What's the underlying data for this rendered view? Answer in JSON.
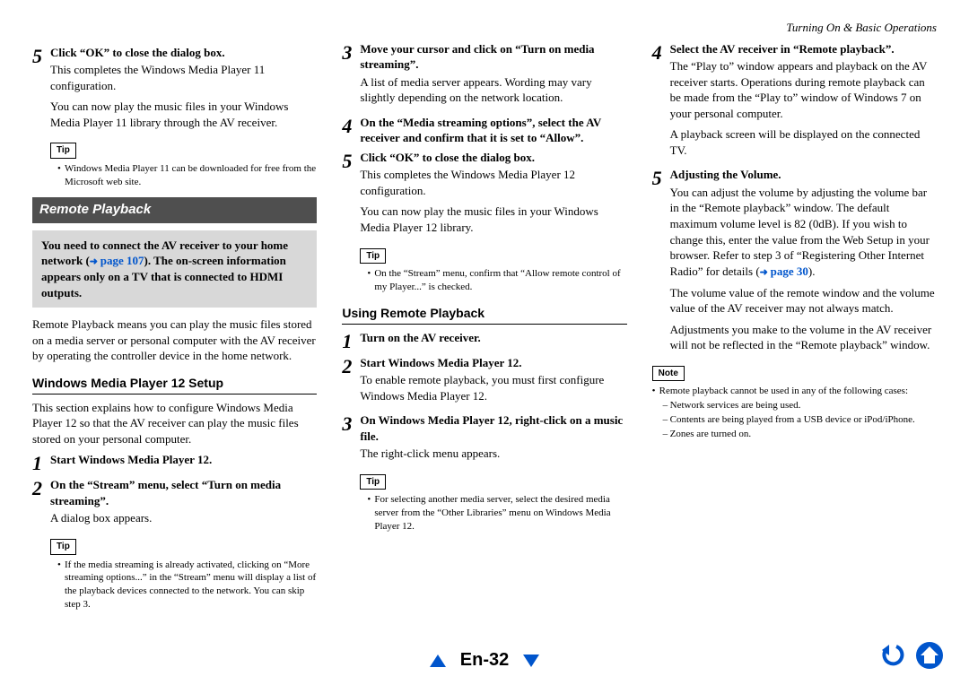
{
  "header": {
    "chapter": "Turning On & Basic Operations"
  },
  "col1": {
    "step5": {
      "num": "5",
      "title": "Click “OK” to close the dialog box.",
      "body1": "This completes the Windows Media Player 11 configuration.",
      "body2": "You can now play the music files in your Windows Media Player 11 library through the AV receiver."
    },
    "tip_label": "Tip",
    "tip_bullet": "Windows Media Player 11 can be downloaded for free from the Microsoft web site.",
    "section_bar": "Remote Playback",
    "callout_pre": "You need to connect the AV receiver to your home network (",
    "callout_link": "page 107",
    "callout_post": "). The on-screen information appears only on a TV that is connected to HDMI outputs.",
    "intro": "Remote Playback means you can play the music files stored on a media server or personal computer with the AV receiver by operating the controller device in the home network.",
    "sub1": "Windows Media Player 12 Setup",
    "sub1_intro": "This section explains how to configure Windows Media Player 12 so that the AV receiver can play the music files stored on your personal computer.",
    "s1": {
      "num": "1",
      "title": "Start Windows Media Player 12."
    },
    "s2": {
      "num": "2",
      "title": "On the “Stream” menu, select “Turn on media streaming”.",
      "body": "A dialog box appears."
    },
    "tip2_label": "Tip",
    "tip2_bullet": "If the media streaming is already activated, clicking on “More streaming options...” in the “Stream” menu will display a list of the playback devices connected to the network. You can skip step 3."
  },
  "col2": {
    "s3": {
      "num": "3",
      "title": "Move your cursor and click on “Turn on media streaming”.",
      "body": "A list of media server appears. Wording may vary slightly depending on the network location."
    },
    "s4": {
      "num": "4",
      "title": "On the “Media streaming options”, select the AV receiver and confirm that it is set to “Allow”."
    },
    "s5": {
      "num": "5",
      "title": "Click “OK” to close the dialog box.",
      "body1": "This completes the Windows Media Player 12 configuration.",
      "body2": "You can now play the music files in your Windows Media Player 12 library."
    },
    "tip_label": "Tip",
    "tip_bullet": "On the “Stream” menu, confirm that “Allow remote control of my Player...” is checked.",
    "sub": "Using Remote Playback",
    "u1": {
      "num": "1",
      "title": "Turn on the AV receiver."
    },
    "u2": {
      "num": "2",
      "title": "Start Windows Media Player 12.",
      "body": "To enable remote playback, you must first configure Windows Media Player 12."
    },
    "u3": {
      "num": "3",
      "title": "On Windows Media Player 12, right-click on a music file.",
      "body": "The right-click menu appears."
    },
    "tip2_label": "Tip",
    "tip2_bullet": "For selecting another media server, select the desired media server from the “Other Libraries” menu on Windows Media Player 12.",
    "u4": {
      "num": "4",
      "title": "Select the AV receiver in “Remote playback”.",
      "body1": "The “Play to” window appears and playback on the AV receiver starts. Operations during remote playback can be made from the “Play to” window of Windows 7 on your personal computer.",
      "body2": "A playback screen will be displayed on the connected TV."
    }
  },
  "col3": {
    "u5": {
      "num": "5",
      "title": "Adjusting the Volume.",
      "body1_pre": "You can adjust the volume by adjusting the volume bar in the “Remote playback” window. The default maximum volume level is 82 (0dB). If you wish to change this, enter the value from the Web Setup in your browser. Refer to step 3 of “Registering Other Internet Radio” for details (",
      "body1_link": "page 30",
      "body1_post": ").",
      "body2": "The volume value of the remote window and the volume value of the AV receiver may not always match.",
      "body3": "Adjustments you make to the volume in the AV receiver will not be reflected in the “Remote playback” window."
    },
    "note_label": "Note",
    "note_intro": "Remote playback cannot be used in any of the following cases:",
    "note_items": [
      "Network services are being used.",
      "Contents are being played from a USB device or iPod/iPhone.",
      "Zones are turned on."
    ]
  },
  "footer": {
    "page_num": "En-32"
  }
}
